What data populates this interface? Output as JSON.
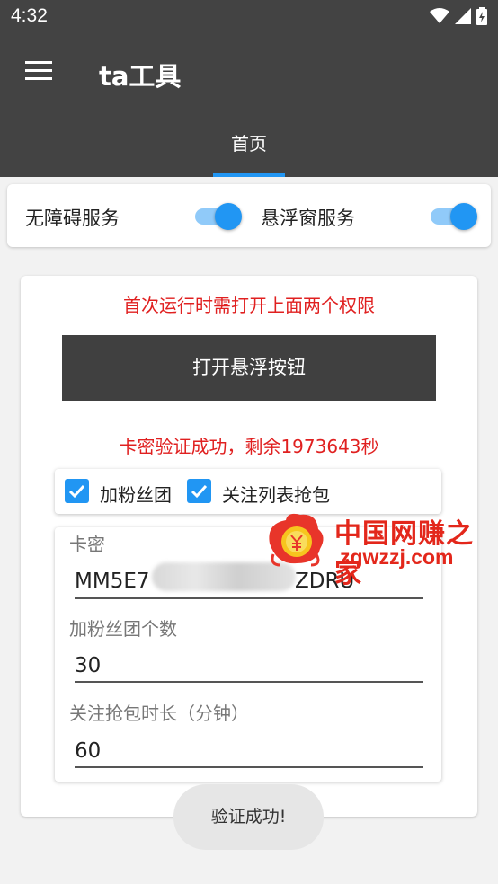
{
  "status_bar": {
    "time": "4:32"
  },
  "app_bar": {
    "title": "ta工具"
  },
  "tabs": [
    {
      "label": "首页",
      "selected": true
    }
  ],
  "permissions": {
    "accessibility": {
      "label": "无障碍服务",
      "enabled": true
    },
    "overlay": {
      "label": "悬浮窗服务",
      "enabled": true
    }
  },
  "main": {
    "first_run_hint": "首次运行时需打开上面两个权限",
    "open_float_button": "打开悬浮按钮",
    "verify_status": "卡密验证成功，剩余1973643秒"
  },
  "options": {
    "add_fans_group": {
      "label": "加粉丝团",
      "checked": true
    },
    "follow_list_grab": {
      "label": "关注列表抢包",
      "checked": true
    }
  },
  "form": {
    "card_key": {
      "label": "卡密",
      "value_start": "MM5E7",
      "value_end": "ZDRU"
    },
    "fans_group_count": {
      "label": "加粉丝团个数",
      "value": "30"
    },
    "grab_duration": {
      "label": "关注抢包时长（分钟）",
      "value": "60"
    }
  },
  "toast": {
    "text": "验证成功!"
  },
  "watermark": {
    "name": "中国网赚之家",
    "url": "zgwzzj.com"
  },
  "colors": {
    "app_bar": "#434343",
    "accent": "#2196f3",
    "hint_red": "#e02020"
  }
}
